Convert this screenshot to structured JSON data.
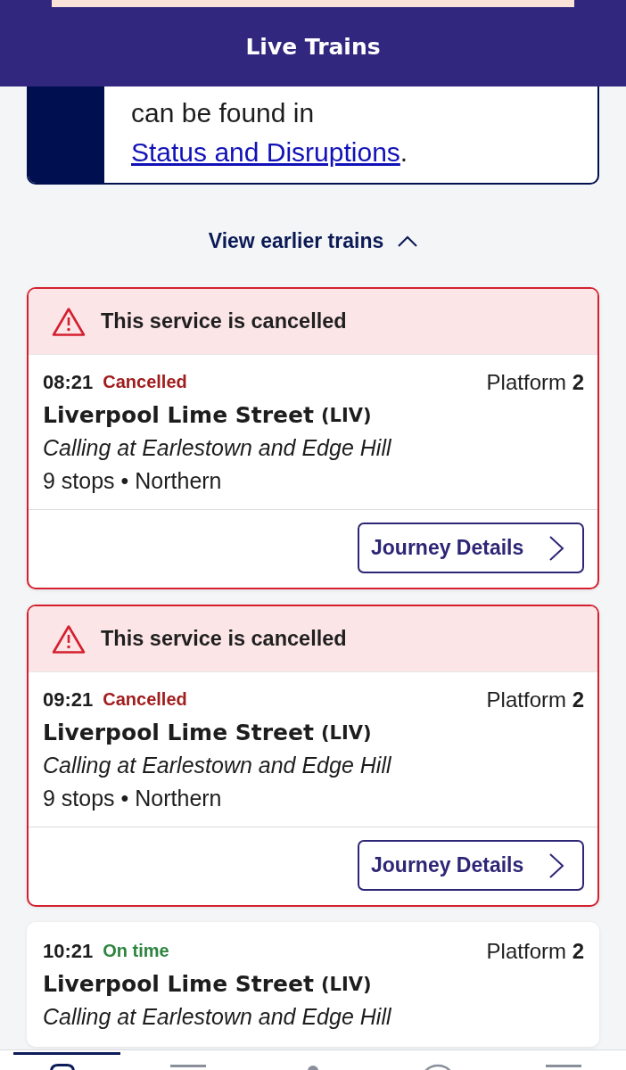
{
  "header": {
    "title": "Live Trains"
  },
  "notice": {
    "text": "can be found in ",
    "link": "Status and Disruptions",
    "end": "."
  },
  "earlier_trains": {
    "label": "View earlier trains",
    "expanded": true
  },
  "services": [
    {
      "kind": "cancelled",
      "alert": "This service is cancelled",
      "time": "08:21",
      "status": "Cancelled",
      "platform": "Platform **2**",
      "destination": "Liverpool Lime Street",
      "code": "(LIV)",
      "calling": "Calling at Earlestown and Edge Hill",
      "details": "9 stops • Northern",
      "button": "Journey Details"
    },
    {
      "kind": "cancelled",
      "alert": "This service is cancelled",
      "time": "09:21",
      "status": "Cancelled",
      "platform": "Platform **2**",
      "destination": "Liverpool Lime Street",
      "code": "(LIV)",
      "calling": "Calling at Earlestown and Edge Hill",
      "details": "9 stops • Northern",
      "button": "Journey Details"
    },
    {
      "kind": "on_time",
      "time": "10:21",
      "status": "On time",
      "platform": "Platform **2**",
      "destination": "Liverpool Lime Street",
      "code": "(LIV)",
      "calling": "Calling at Earlestown and Edge Hill"
    }
  ],
  "tab_bar": {
    "items": [
      {
        "selected": true
      },
      {
        "selected": false
      },
      {
        "selected": false
      },
      {
        "selected": false
      },
      {
        "selected": false
      }
    ]
  }
}
